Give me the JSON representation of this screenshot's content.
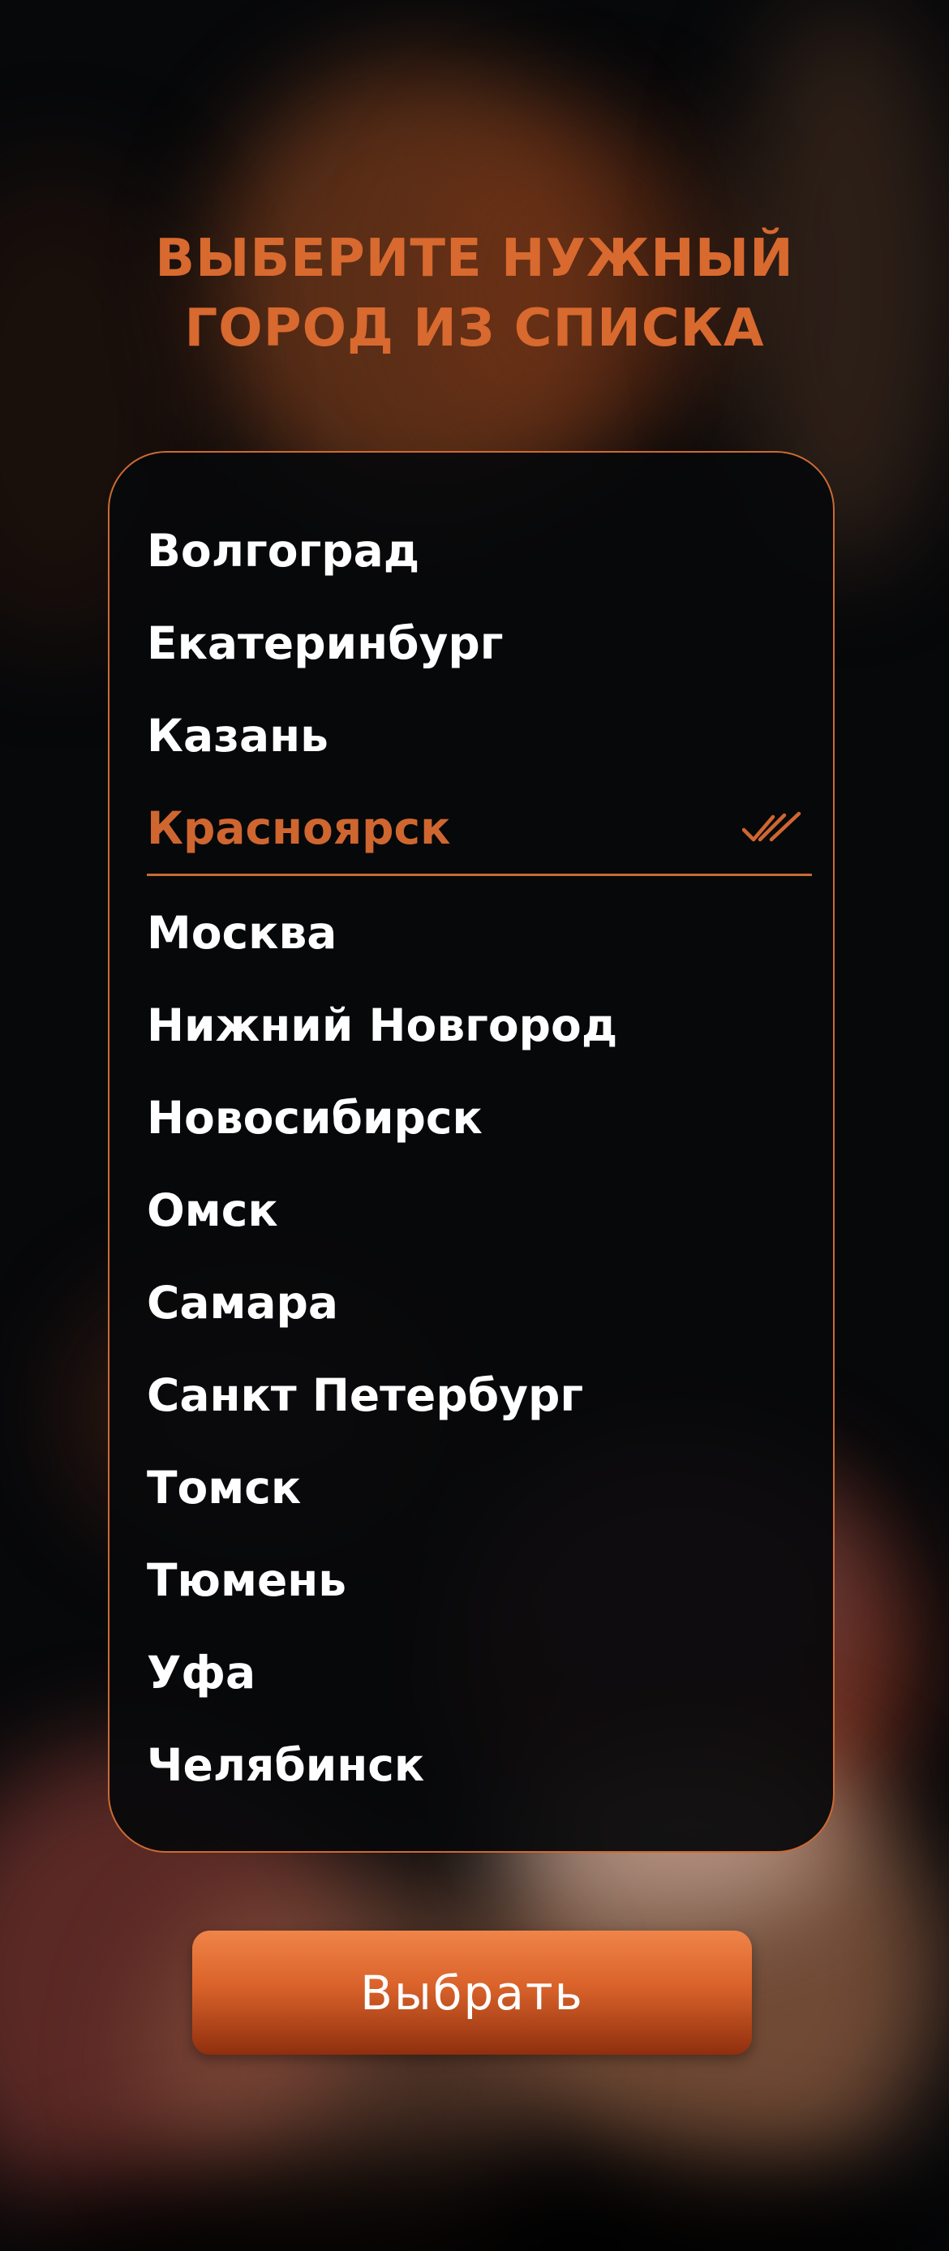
{
  "title": {
    "line1": "ВЫБЕРИТЕ НУЖНЫЙ",
    "line2": "ГОРОД ИЗ СПИСКА"
  },
  "cities": [
    {
      "label": "Волгоград",
      "selected": false
    },
    {
      "label": "Екатеринбург",
      "selected": false
    },
    {
      "label": "Казань",
      "selected": false
    },
    {
      "label": "Красноярск",
      "selected": true
    },
    {
      "label": "Москва",
      "selected": false
    },
    {
      "label": "Нижний Новгород",
      "selected": false
    },
    {
      "label": "Новосибирск",
      "selected": false
    },
    {
      "label": "Омск",
      "selected": false
    },
    {
      "label": "Самара",
      "selected": false
    },
    {
      "label": "Санкт Петербург",
      "selected": false
    },
    {
      "label": "Томск",
      "selected": false
    },
    {
      "label": "Тюмень",
      "selected": false
    },
    {
      "label": "Уфа",
      "selected": false
    },
    {
      "label": "Челябинск",
      "selected": false
    }
  ],
  "selected_icon": "double-check-icon",
  "select_button": {
    "label": "Выбрать"
  },
  "colors": {
    "accent": "#d8692f",
    "panel_border": "#cc6a32",
    "text": "#ffffff",
    "button_top": "#f08448",
    "button_bottom": "#8f2f0e"
  }
}
